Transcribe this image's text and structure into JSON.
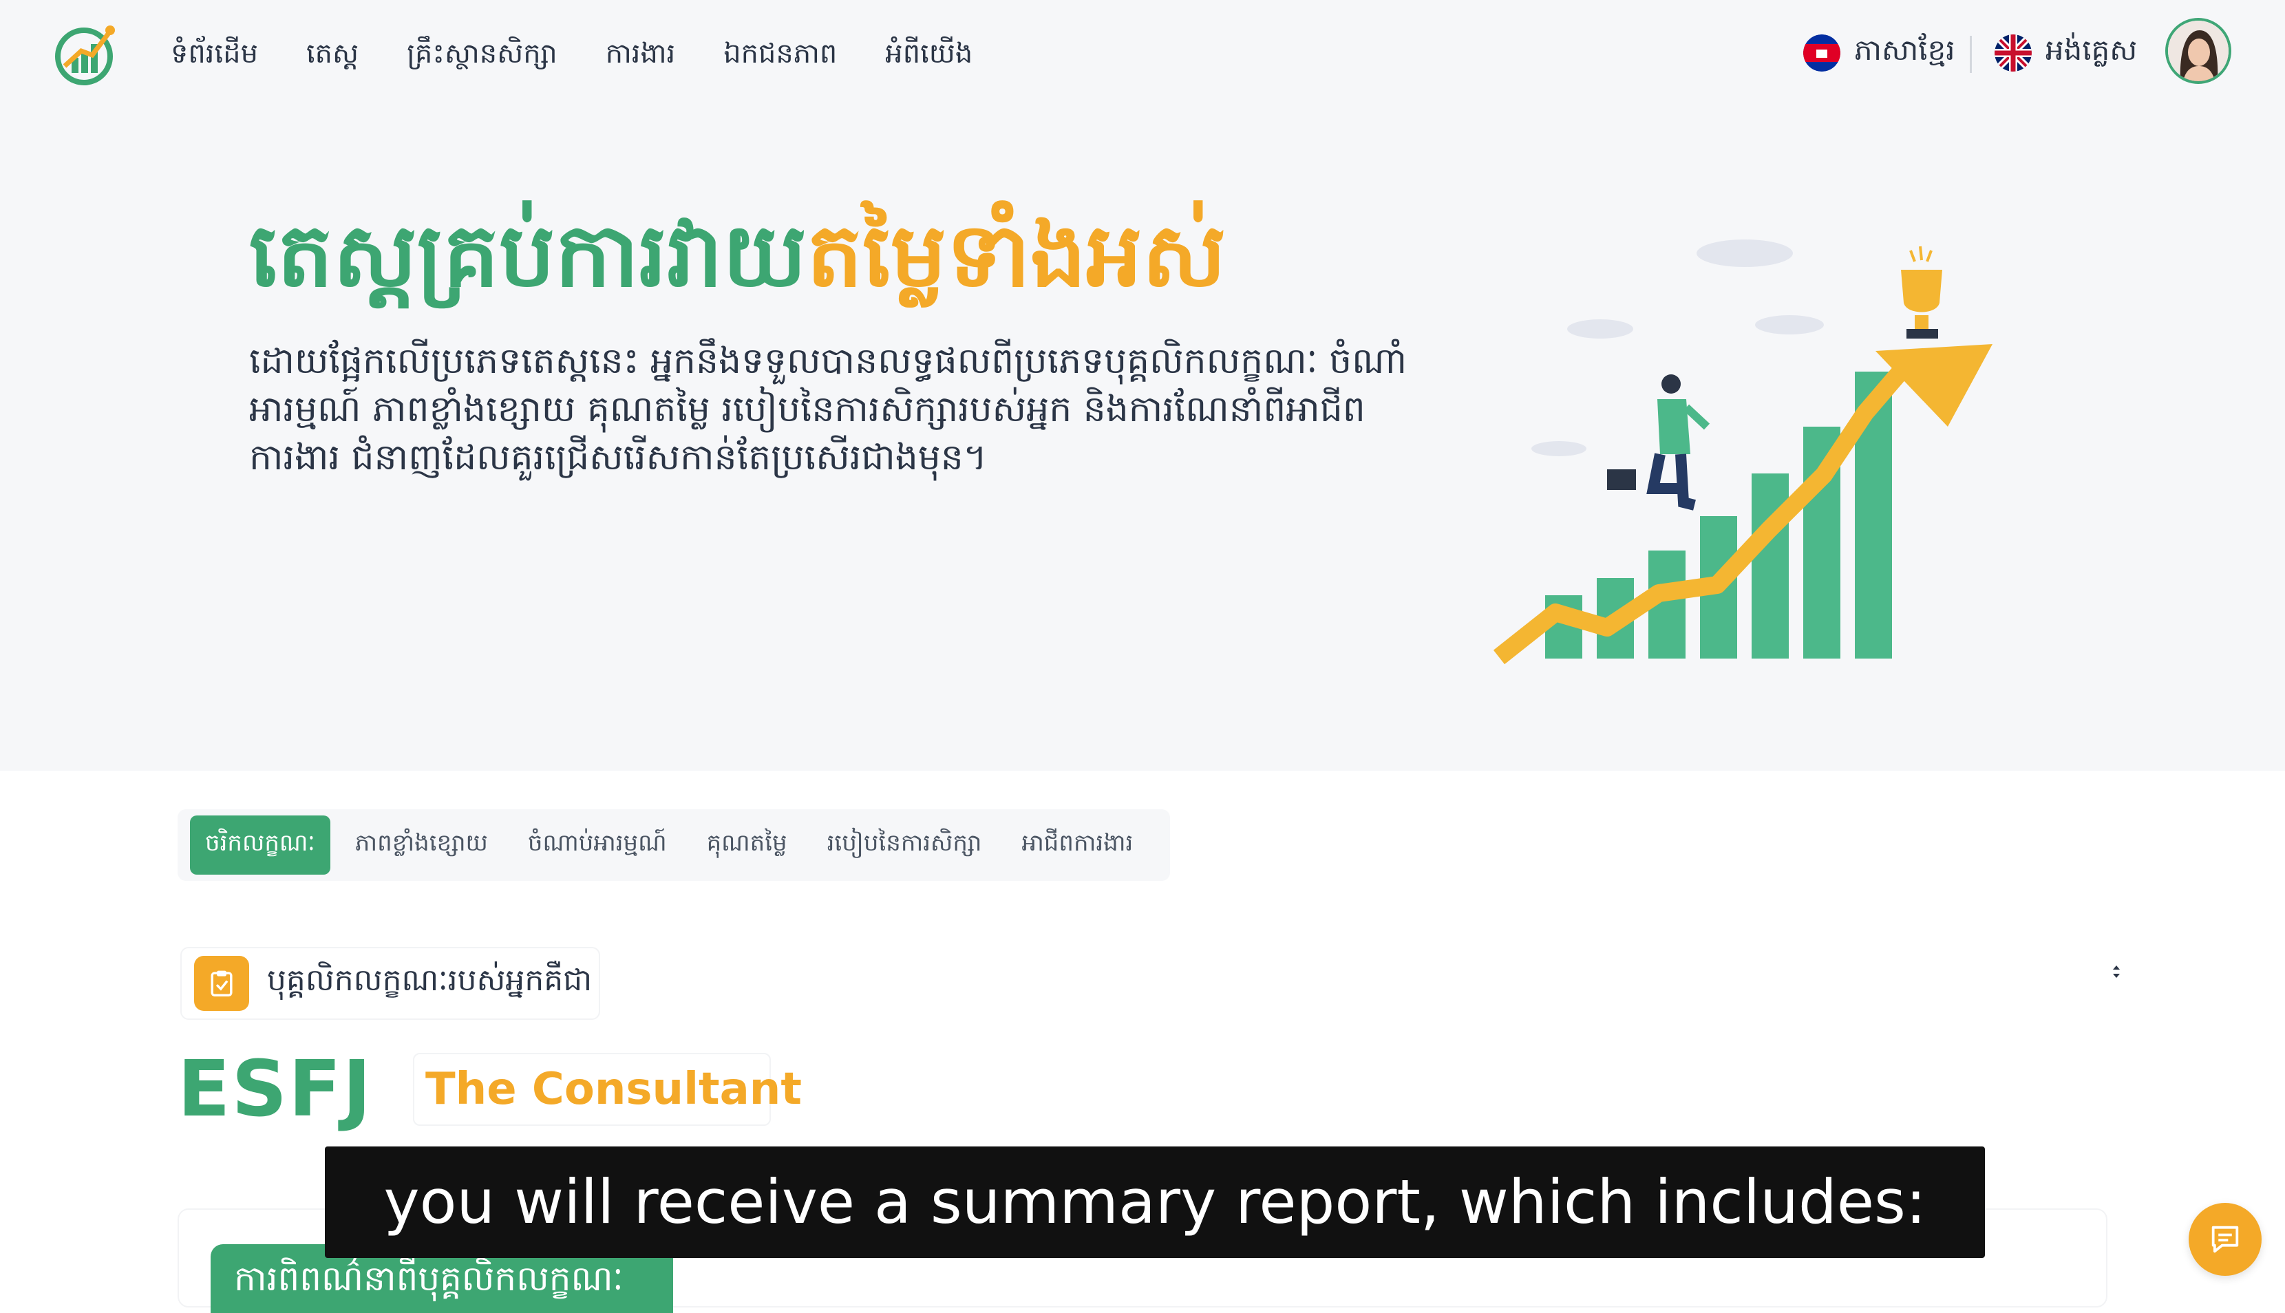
{
  "nav": {
    "links": [
      "ទំព័រដើម",
      "តេស្ត",
      "គ្រឹះស្ថានសិក្សា",
      "ការងារ",
      "ឯកជនភាព",
      "អំពីយើង"
    ],
    "lang_khmer": "ភាសាខ្មែរ",
    "lang_english": "អង់គ្លេស"
  },
  "hero": {
    "title_part1": "តេស្តគ្រប់ការវាយ",
    "title_part2": "តម្លៃទាំងអស់",
    "description": "ដោយផ្អែកលើប្រភេទតេស្តនេះ អ្នកនឹងទទួលបានលទ្ធផលពីប្រភេទបុគ្គលិកលក្ខណៈ ចំណាំអារម្មណ៍ ភាពខ្លាំងខ្សោយ គុណតម្លៃ របៀបនៃការសិក្សារបស់អ្នក និងការណែនាំពីអាជីពការងារ ជំនាញដែលគួរជ្រើសរើសកាន់តែប្រសើរជាងមុន។"
  },
  "tabs": [
    "ចរិកលក្ខណៈ",
    "ភាពខ្លាំងខ្សោយ",
    "ចំណាប់អារម្មណ៍",
    "គុណតម្លៃ",
    "របៀបនៃការសិក្សា",
    "អាជីពការងារ"
  ],
  "result": {
    "chip_label": "បុគ្គលិកលក្ខណៈរបស់អ្នកគឺជា",
    "code": "ESFJ",
    "nickname": "The Consultant",
    "description_pill": "ការពិពណ៌នាពីបុគ្គលិកលក្ខណៈ"
  },
  "subtitle": "you will receive a summary report, which includes:",
  "colors": {
    "green": "#3da672",
    "orange": "#f4a928",
    "background": "#f6f7f9"
  },
  "icons": {
    "logo": "growth-logo",
    "clipboard": "clipboard-check-icon",
    "sort": "sort-arrows-icon",
    "chat": "chat-icon"
  }
}
